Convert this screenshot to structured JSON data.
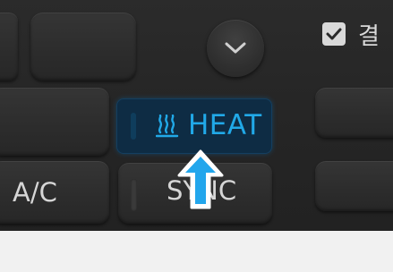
{
  "screenshot": "car-climate-control-panel",
  "checkbox": {
    "checked": true,
    "label": "결"
  },
  "dropdown_button": {
    "icon": "chevron-down-icon"
  },
  "heat_button": {
    "label": "HEAT",
    "icon": "rear-defrost-heat-icon",
    "state": "highlighted",
    "accent": "#21a9e8",
    "background": "#0e2c44"
  },
  "ac_button": {
    "label": "A/C"
  },
  "sync_button": {
    "label": "SYNC"
  },
  "pointer": {
    "icon": "up-arrow-pointer-icon",
    "color": "#22a6ec"
  },
  "colors": {
    "panel": "#262626",
    "key": "#303030",
    "text": "#d6d6d6",
    "strip": "#f1f1f1"
  }
}
